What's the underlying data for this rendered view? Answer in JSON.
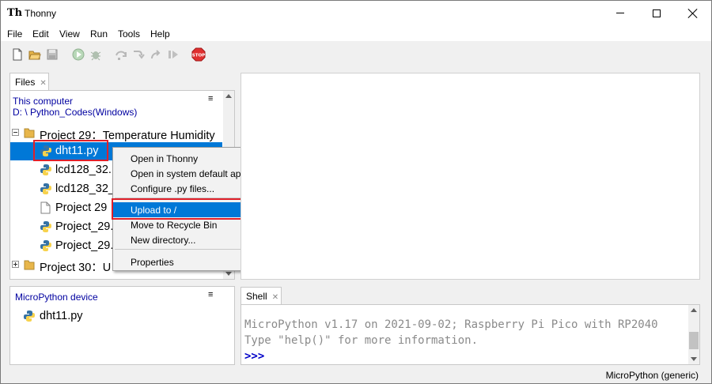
{
  "window": {
    "title": "Thonny",
    "app_icon_glyph": "Th"
  },
  "menu": [
    "File",
    "Edit",
    "View",
    "Run",
    "Tools",
    "Help"
  ],
  "toolbar": {
    "icons": [
      "new-file-icon",
      "open-folder-icon",
      "save-icon",
      "run-icon",
      "debug-icon",
      "step-over-icon",
      "step-into-icon",
      "step-out-icon",
      "resume-icon",
      "stop-icon"
    ],
    "stop_label": "STOP"
  },
  "files_pane": {
    "tab_label": "Files",
    "location_label": "This computer",
    "path": "D: \\ Python_Codes(Windows)",
    "menu_glyph": "≡",
    "tree": [
      {
        "name": "Project 29：Temperature Humidity",
        "type": "folder",
        "expanded": true
      },
      {
        "name": "dht11.py",
        "type": "py",
        "selected": true
      },
      {
        "name": "lcd128_32.",
        "type": "py"
      },
      {
        "name": "lcd128_32_",
        "type": "py"
      },
      {
        "name": "Project 29",
        "type": "file"
      },
      {
        "name": "Project_29.",
        "type": "py"
      },
      {
        "name": "Project_29.",
        "type": "py"
      },
      {
        "name": "Project 30：U",
        "type": "folder",
        "expanded": false
      }
    ]
  },
  "context_menu": {
    "items": [
      {
        "label": "Open in Thonny"
      },
      {
        "label": "Open in system default app"
      },
      {
        "label": "Configure .py files..."
      },
      {
        "label": "Upload to /",
        "highlighted": true
      },
      {
        "label": "Move to Recycle Bin"
      },
      {
        "label": "New directory..."
      },
      {
        "label": "Properties"
      }
    ]
  },
  "device_pane": {
    "title": "MicroPython device",
    "menu_glyph": "≡",
    "files": [
      {
        "name": "dht11.py",
        "type": "py"
      }
    ]
  },
  "shell": {
    "tab_label": "Shell",
    "lines": [
      "MicroPython v1.17 on 2021-09-02; Raspberry Pi Pico with RP2040",
      "Type \"help()\" for more information."
    ],
    "prompt": ">>>"
  },
  "status_bar": {
    "interpreter": "MicroPython (generic)"
  },
  "colors": {
    "selection": "#0078d7",
    "highlight_box": "#e0202a",
    "location_text": "#0000a0",
    "shell_text": "#8a8a8a",
    "prompt": "#0000c8"
  }
}
